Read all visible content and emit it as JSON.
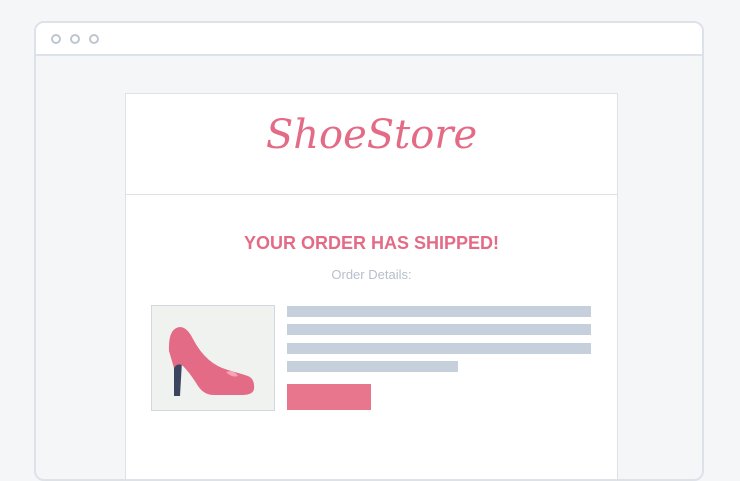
{
  "window": {
    "controls": [
      "window-dot",
      "window-dot",
      "window-dot"
    ]
  },
  "email": {
    "brand": "ShoeStore",
    "headline": "YOUR ORDER HAS SHIPPED!",
    "subheading": "Order Details:",
    "product_image": "high-heel-shoe-icon",
    "placeholder_lines": 4,
    "button": "placeholder-button"
  },
  "colors": {
    "brand": "#e36b86",
    "accent_button": "#e8768d",
    "placeholder": "#c6cfdc",
    "muted_text": "#b6bfcc",
    "shoe_heel": "#3b4560",
    "background": "#f5f6f8",
    "border": "#dde2e9"
  }
}
